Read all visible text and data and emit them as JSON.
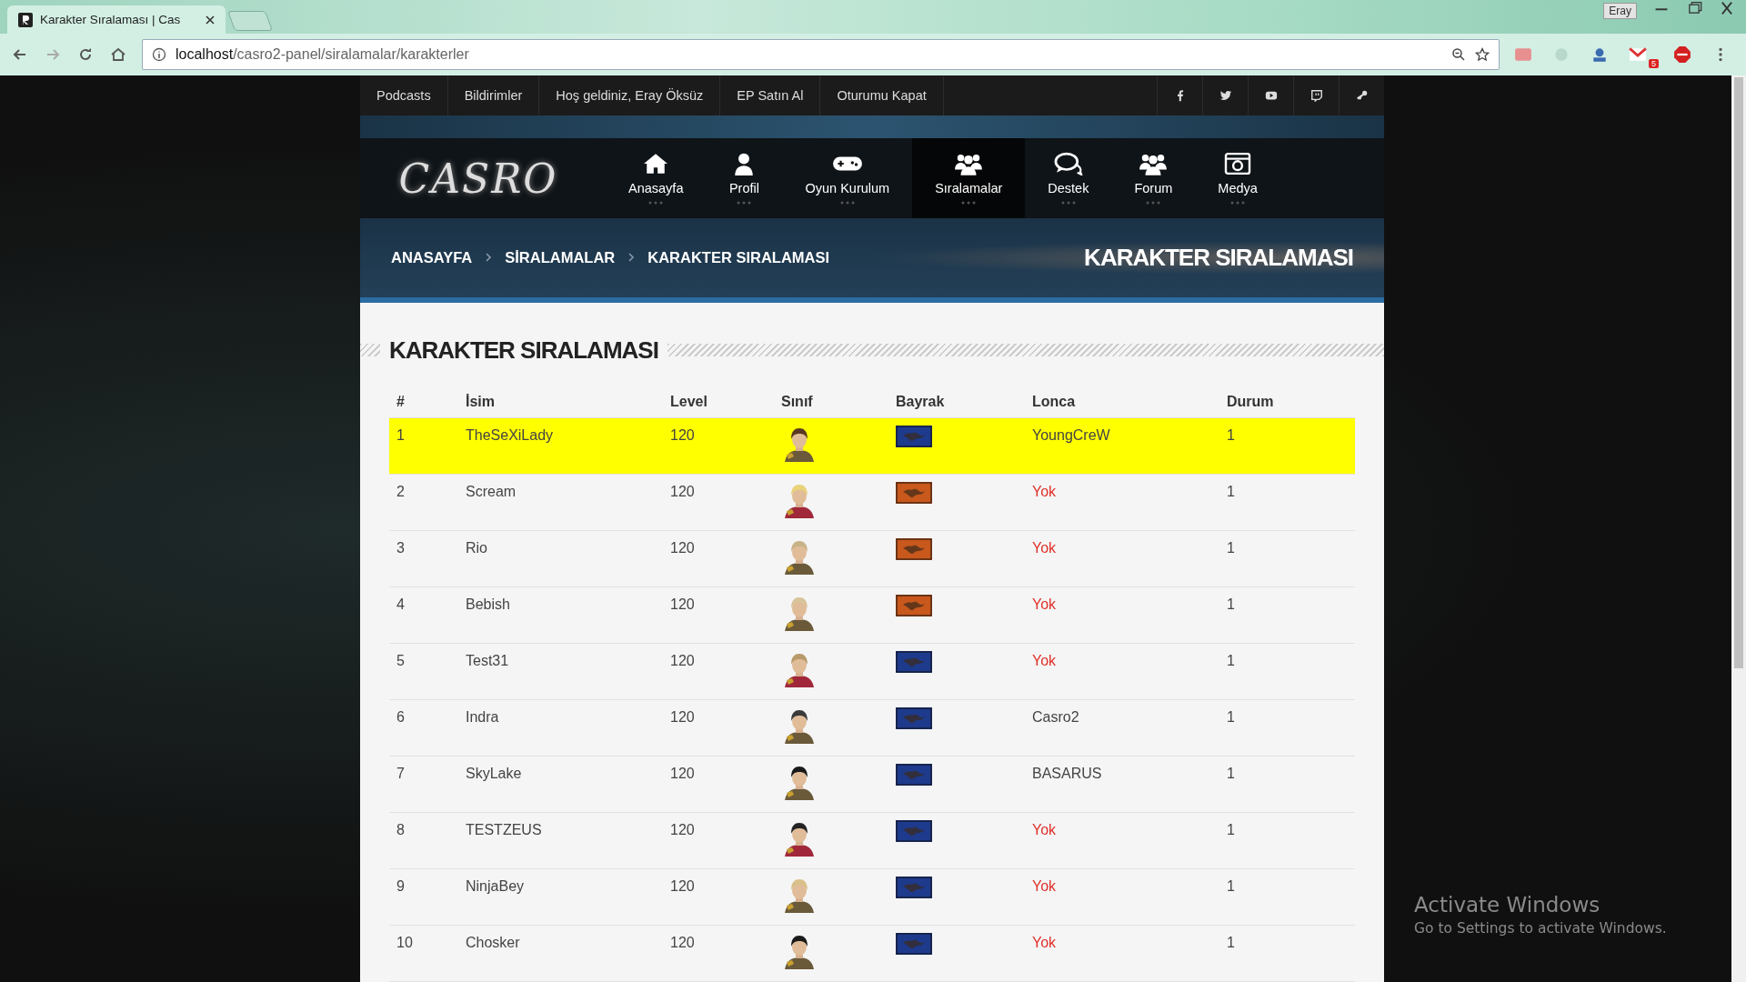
{
  "browser": {
    "tab_title": "Karakter Sıralaması | Cas",
    "url_host": "localhost",
    "url_path": "/casro2-panel/siralamalar/karakterler",
    "profile": "Eray",
    "mail_badge": "5"
  },
  "top_links": [
    "Podcasts",
    "Bildirimler",
    "Hoş geldiniz, Eray Öksüz",
    "EP Satın Al",
    "Oturumu Kapat"
  ],
  "social": [
    {
      "kind": "facebook"
    },
    {
      "kind": "twitter"
    },
    {
      "kind": "youtube"
    },
    {
      "kind": "twitch"
    },
    {
      "kind": "steam"
    }
  ],
  "logo": "CASRO",
  "nav": [
    {
      "label": "Anasayfa",
      "kind": "home",
      "selected": false
    },
    {
      "label": "Profil",
      "kind": "user",
      "selected": false
    },
    {
      "label": "Oyun Kurulum",
      "kind": "gamepad",
      "selected": false
    },
    {
      "label": "Sıralamalar",
      "kind": "users",
      "selected": true
    },
    {
      "label": "Destek",
      "kind": "chat",
      "selected": false
    },
    {
      "label": "Forum",
      "kind": "users",
      "selected": false
    },
    {
      "label": "Medya",
      "kind": "camera",
      "selected": false
    }
  ],
  "breadcrumb": [
    "ANASAYFA",
    "SİRALAMALAR",
    "KARAKTER SIRALAMASI"
  ],
  "banner_title": "KARAKTER SIRALAMASI",
  "section_title": "KARAKTER SIRALAMASI",
  "table": {
    "columns": [
      "#",
      "İsim",
      "Level",
      "Sınıf",
      "Bayrak",
      "Lonca",
      "Durum"
    ],
    "rows": [
      {
        "rank": "1",
        "name": "TheSeXiLady",
        "level": "120",
        "color": "#1e3a8c",
        "guild": "YoungCreW",
        "guild_none": false,
        "status": "1",
        "highlighted": true
      },
      {
        "rank": "2",
        "name": "Scream",
        "level": "120",
        "color": "#c8581c",
        "guild": "Yok",
        "guild_none": true,
        "status": "1",
        "highlighted": false
      },
      {
        "rank": "3",
        "name": "Rio",
        "level": "120",
        "color": "#c8581c",
        "guild": "Yok",
        "guild_none": true,
        "status": "1",
        "highlighted": false
      },
      {
        "rank": "4",
        "name": "Bebish",
        "level": "120",
        "color": "#c8581c",
        "guild": "Yok",
        "guild_none": true,
        "status": "1",
        "highlighted": false
      },
      {
        "rank": "5",
        "name": "Test31",
        "level": "120",
        "color": "#1e3a8c",
        "guild": "Yok",
        "guild_none": true,
        "status": "1",
        "highlighted": false
      },
      {
        "rank": "6",
        "name": "Indra",
        "level": "120",
        "color": "#1e3a8c",
        "guild": "Casro2",
        "guild_none": false,
        "status": "1",
        "highlighted": false
      },
      {
        "rank": "7",
        "name": "SkyLake",
        "level": "120",
        "color": "#1e3a8c",
        "guild": "BASARUS",
        "guild_none": false,
        "status": "1",
        "highlighted": false
      },
      {
        "rank": "8",
        "name": "TESTZEUS",
        "level": "120",
        "color": "#1e3a8c",
        "guild": "Yok",
        "guild_none": true,
        "status": "1",
        "highlighted": false
      },
      {
        "rank": "9",
        "name": "NinjaBey",
        "level": "120",
        "color": "#1e3a8c",
        "guild": "Yok",
        "guild_none": true,
        "status": "1",
        "highlighted": false
      },
      {
        "rank": "10",
        "name": "Chosker",
        "level": "120",
        "color": "#1e3a8c",
        "guild": "Yok",
        "guild_none": true,
        "status": "1",
        "highlighted": false
      }
    ]
  },
  "os_notice": {
    "title": "Activate Windows",
    "text": "Go to Settings to activate Windows."
  }
}
